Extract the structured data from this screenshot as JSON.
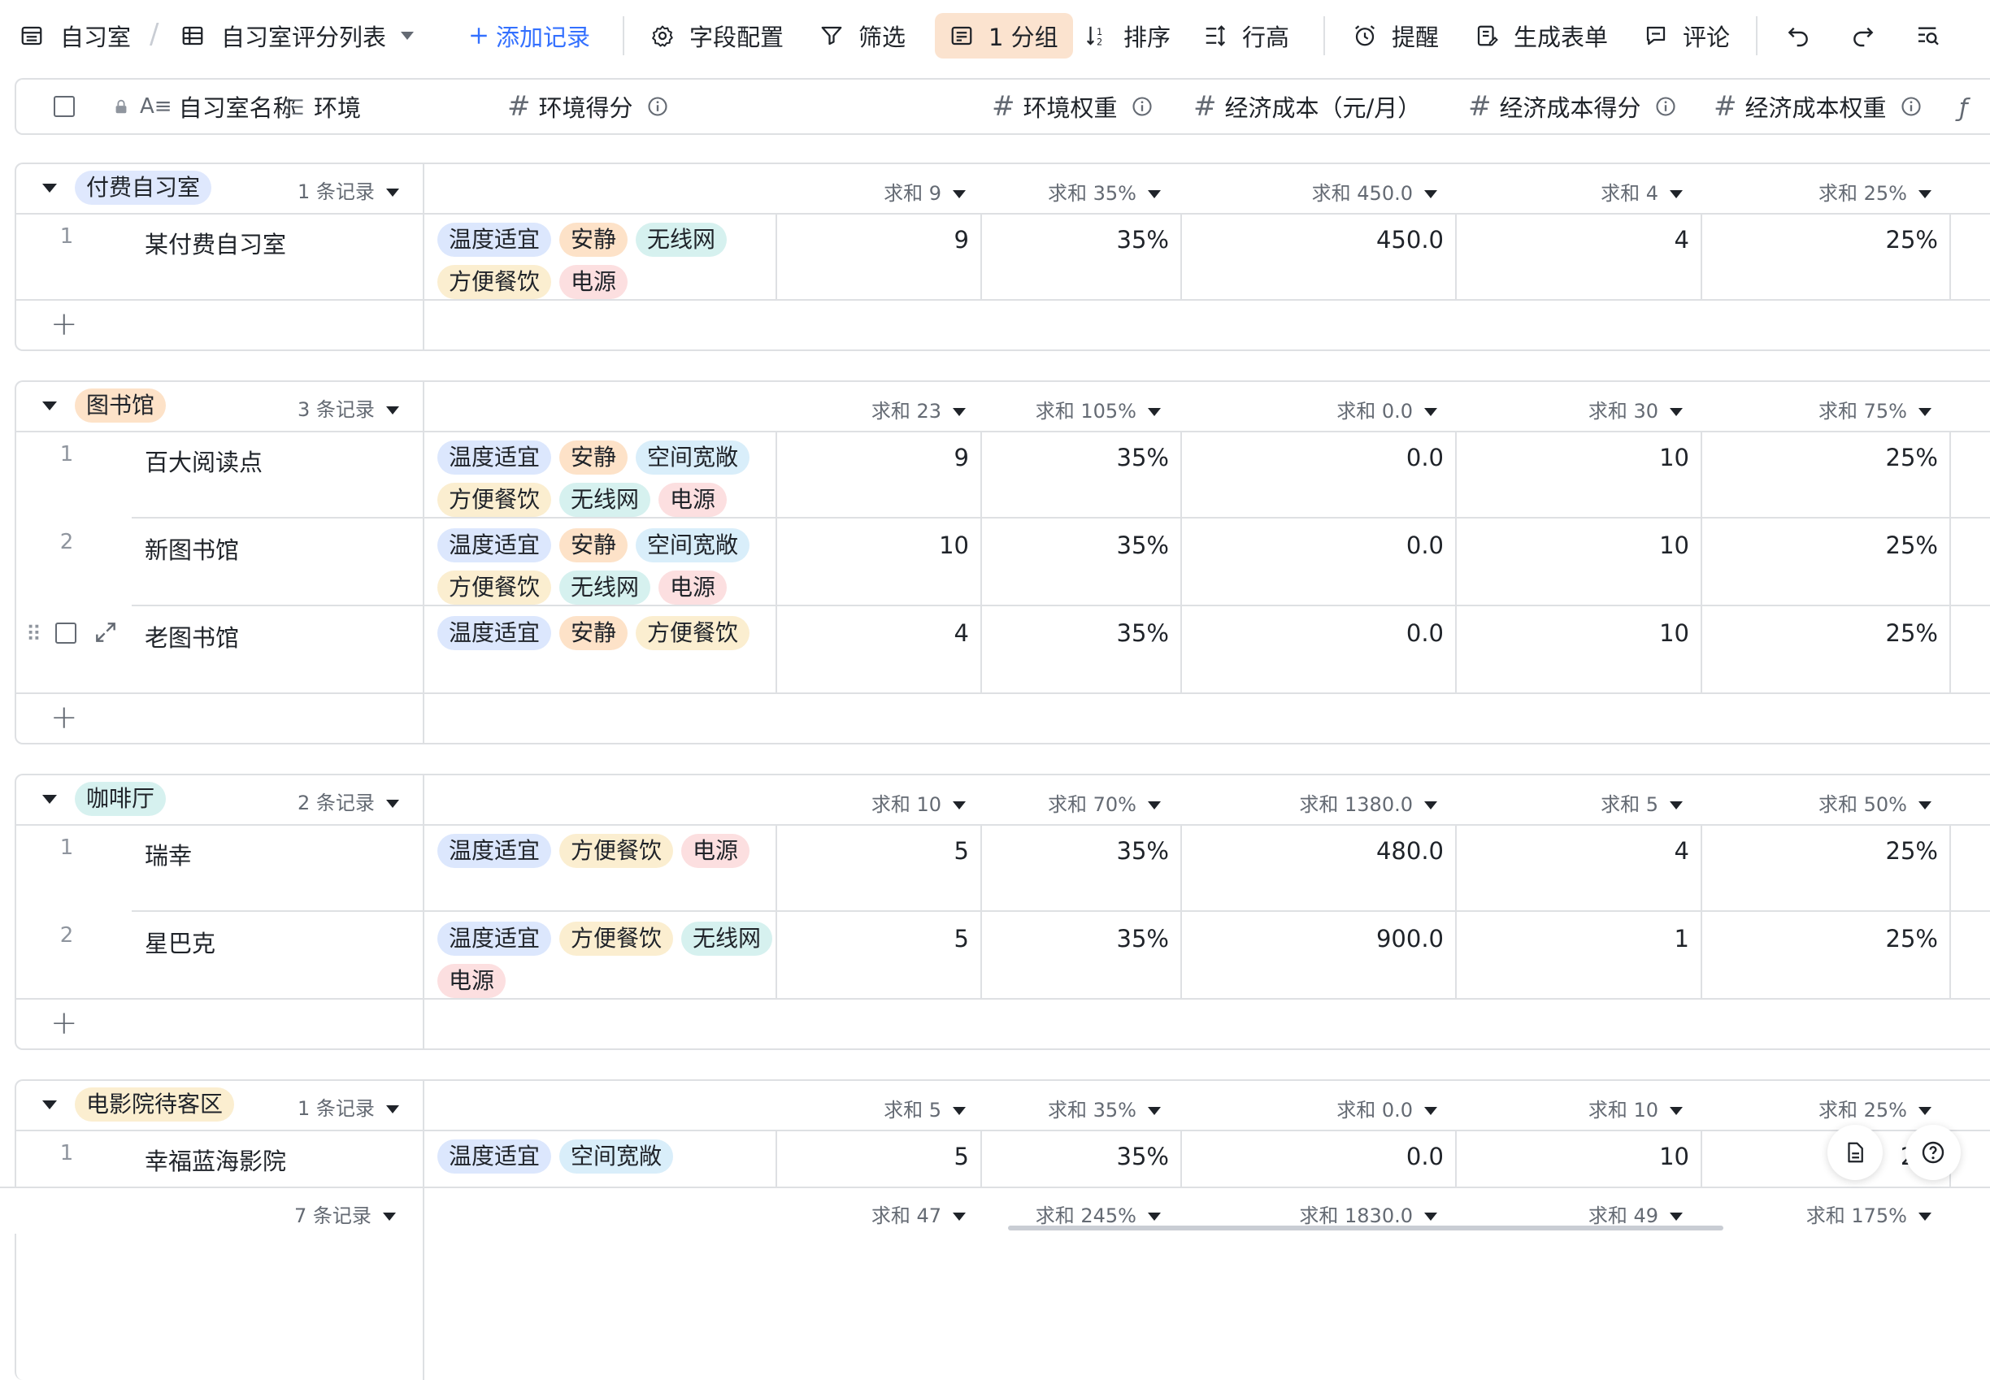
{
  "toolbar": {
    "app_name": "自习室",
    "view_name": "自习室评分列表",
    "add_record": "添加记录",
    "field_config": "字段配置",
    "filter": "筛选",
    "group": "1 分组",
    "sort": "排序",
    "row_height": "行高",
    "reminder": "提醒",
    "generate_form": "生成表单",
    "comment": "评论"
  },
  "columns": {
    "name": "自习室名称",
    "environment": "环境",
    "env_score": "环境得分",
    "env_weight": "环境权重",
    "econ_cost": "经济成本（元/月）",
    "econ_score": "经济成本得分",
    "econ_weight": "经济成本权重"
  },
  "tag_colors": {
    "温度适宜": "#dce7fd",
    "安静": "#fde2c8",
    "无线网": "#d6f1ef",
    "方便餐饮": "#fbeed0",
    "电源": "#fcdfe0",
    "空间宽敞": "#d9eefa"
  },
  "groups": [
    {
      "label": "付费自习室",
      "color": "#dfe8fd",
      "count": "1 条记录",
      "sums": {
        "env_score": "求和 9",
        "env_weight": "求和 35%",
        "econ_cost": "求和 450.0",
        "econ_score": "求和 4",
        "econ_weight": "求和 25%"
      },
      "rows": [
        {
          "num": "1",
          "name": "某付费自习室",
          "tags": [
            "温度适宜",
            "安静",
            "无线网",
            "方便餐饮",
            "电源"
          ],
          "env_score": "9",
          "env_weight": "35%",
          "econ_cost": "450.0",
          "econ_score": "4",
          "econ_weight": "25%"
        }
      ]
    },
    {
      "label": "图书馆",
      "color": "#fde2c8",
      "count": "3 条记录",
      "sums": {
        "env_score": "求和 23",
        "env_weight": "求和 105%",
        "econ_cost": "求和 0.0",
        "econ_score": "求和 30",
        "econ_weight": "求和 75%"
      },
      "rows": [
        {
          "num": "1",
          "name": "百大阅读点",
          "tags": [
            "温度适宜",
            "安静",
            "空间宽敞",
            "方便餐饮",
            "无线网",
            "电源"
          ],
          "env_score": "9",
          "env_weight": "35%",
          "econ_cost": "0.0",
          "econ_score": "10",
          "econ_weight": "25%"
        },
        {
          "num": "2",
          "name": "新图书馆",
          "tags": [
            "温度适宜",
            "安静",
            "空间宽敞",
            "方便餐饮",
            "无线网",
            "电源"
          ],
          "env_score": "10",
          "env_weight": "35%",
          "econ_cost": "0.0",
          "econ_score": "10",
          "econ_weight": "25%"
        },
        {
          "num": "",
          "name": "老图书馆",
          "tags": [
            "温度适宜",
            "安静",
            "方便餐饮"
          ],
          "env_score": "4",
          "env_weight": "35%",
          "econ_cost": "0.0",
          "econ_score": "10",
          "econ_weight": "25%"
        }
      ]
    },
    {
      "label": "咖啡厅",
      "color": "#d6f1ef",
      "count": "2 条记录",
      "sums": {
        "env_score": "求和 10",
        "env_weight": "求和 70%",
        "econ_cost": "求和 1380.0",
        "econ_score": "求和 5",
        "econ_weight": "求和 50%"
      },
      "rows": [
        {
          "num": "1",
          "name": "瑞幸",
          "tags": [
            "温度适宜",
            "方便餐饮",
            "电源"
          ],
          "env_score": "5",
          "env_weight": "35%",
          "econ_cost": "480.0",
          "econ_score": "4",
          "econ_weight": "25%"
        },
        {
          "num": "2",
          "name": "星巴克",
          "tags": [
            "温度适宜",
            "方便餐饮",
            "无线网",
            "电源"
          ],
          "env_score": "5",
          "env_weight": "35%",
          "econ_cost": "900.0",
          "econ_score": "1",
          "econ_weight": "25%"
        }
      ]
    },
    {
      "label": "电影院待客区",
      "color": "#fbeed0",
      "count": "1 条记录",
      "sums": {
        "env_score": "求和 5",
        "env_weight": "求和 35%",
        "econ_cost": "求和 0.0",
        "econ_score": "求和 10",
        "econ_weight": "求和 25%"
      },
      "rows": [
        {
          "num": "1",
          "name": "幸福蓝海影院",
          "tags": [
            "温度适宜",
            "空间宽敞"
          ],
          "env_score": "5",
          "env_weight": "35%",
          "econ_cost": "0.0",
          "econ_score": "10",
          "econ_weight": "2..."
        }
      ]
    }
  ],
  "footer": {
    "count": "7 条记录",
    "env_score": "求和 47",
    "env_weight": "求和 245%",
    "econ_cost": "求和 1830.0",
    "econ_score": "求和 49",
    "econ_weight": "求和 175%"
  }
}
